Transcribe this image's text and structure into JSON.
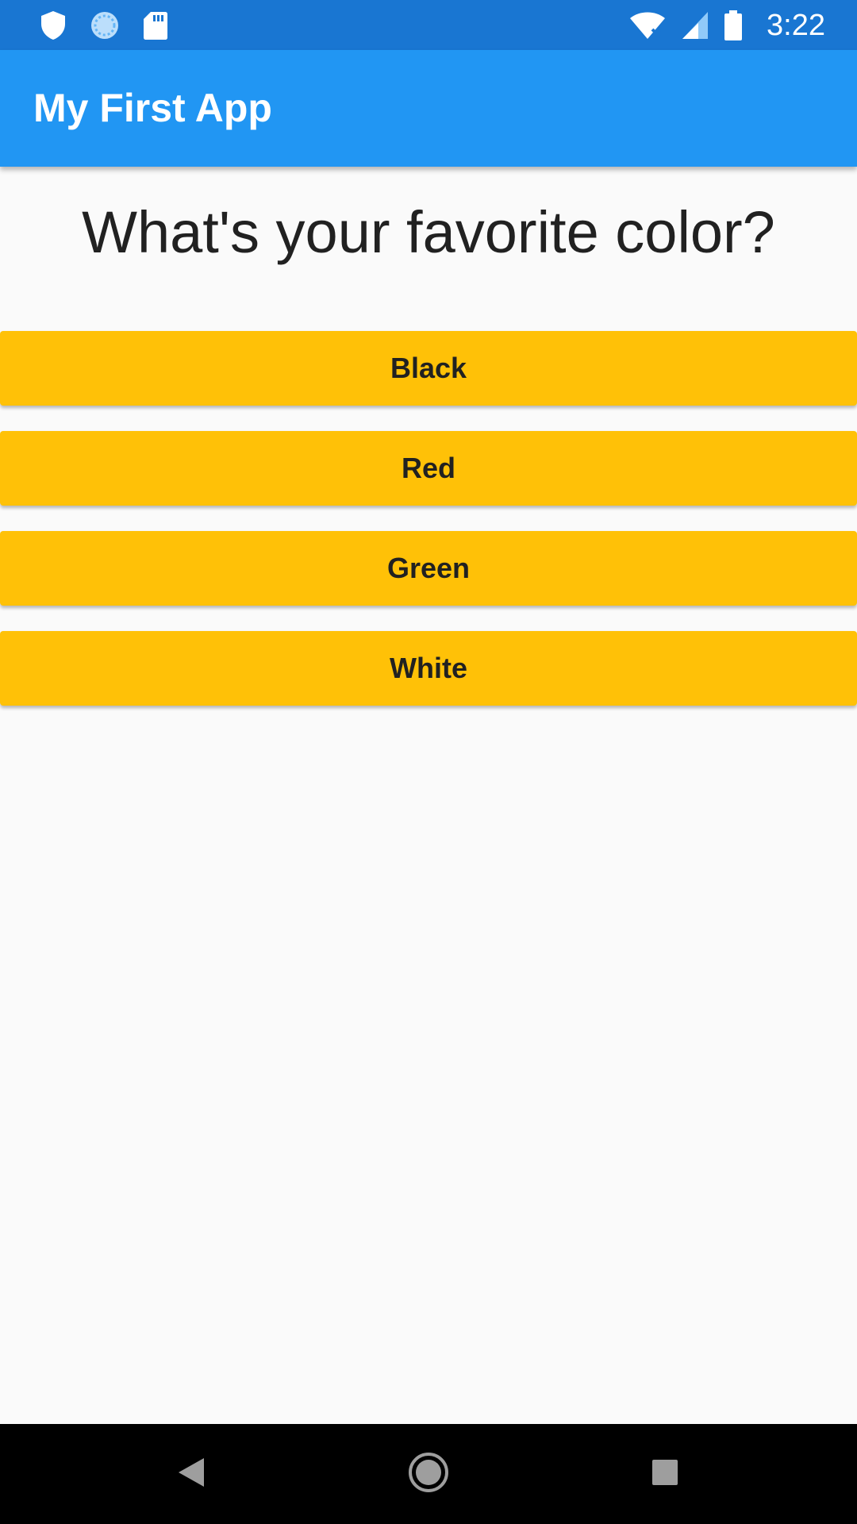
{
  "status_bar": {
    "time": "3:22",
    "left_icons": [
      "shield-icon",
      "sync-icon",
      "sd-card-icon"
    ],
    "right_icons": [
      "wifi-off-icon",
      "signal-icon",
      "battery-icon"
    ],
    "background_color": "#1976d2"
  },
  "app_bar": {
    "title": "My First App",
    "background_color": "#2196f3"
  },
  "question": {
    "text": "What's your favorite color?"
  },
  "answers": [
    {
      "label": "Black"
    },
    {
      "label": "Red"
    },
    {
      "label": "Green"
    },
    {
      "label": "White"
    }
  ],
  "answer_button_color": "#ffc107",
  "nav_bar": {
    "buttons": [
      "back-icon",
      "home-icon",
      "recents-icon"
    ]
  }
}
